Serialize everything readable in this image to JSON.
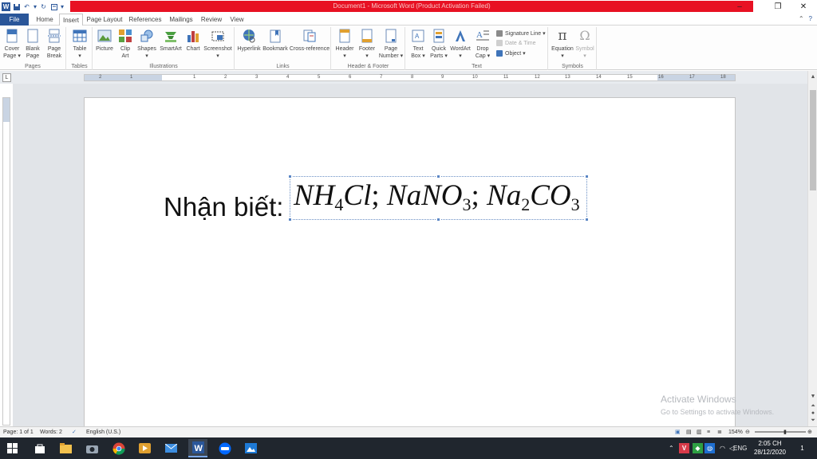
{
  "window": {
    "title": "Document1  -  Microsoft Word (Product Activation Failed)",
    "word_icon": "W"
  },
  "tabs": [
    "File",
    "Home",
    "Insert",
    "Page Layout",
    "References",
    "Mailings",
    "Review",
    "View"
  ],
  "active_tab": "Insert",
  "ribbon": {
    "groups": [
      {
        "label": "Pages",
        "buttons": [
          "Cover\nPage ▾",
          "Blank\nPage",
          "Page\nBreak"
        ]
      },
      {
        "label": "Tables",
        "buttons": [
          "Table\n▾"
        ]
      },
      {
        "label": "Illustrations",
        "buttons": [
          "Picture",
          "Clip\nArt",
          "Shapes\n▾",
          "SmartArt",
          "Chart",
          "Screenshot\n▾"
        ]
      },
      {
        "label": "Links",
        "buttons": [
          "Hyperlink",
          "Bookmark",
          "Cross-reference"
        ]
      },
      {
        "label": "Header & Footer",
        "buttons": [
          "Header\n▾",
          "Footer\n▾",
          "Page\nNumber ▾"
        ]
      },
      {
        "label": "Text",
        "buttons": [
          "Text\nBox ▾",
          "Quick\nParts ▾",
          "WordArt\n▾",
          "Drop\nCap ▾"
        ]
      },
      {
        "label": "Symbols",
        "buttons": [
          "Equation\n▾",
          "Symbol\n▾"
        ]
      }
    ],
    "text_small": [
      "Signature Line ▾",
      "Date & Time",
      "Object ▾"
    ]
  },
  "ruler": {
    "corner": "L",
    "ticks": [
      "2",
      "1",
      "1",
      "2",
      "3",
      "4",
      "5",
      "6",
      "7",
      "8",
      "9",
      "10",
      "11",
      "12",
      "13",
      "14",
      "15",
      "16",
      "17",
      "18"
    ]
  },
  "document": {
    "label": "Nhận biết:",
    "equation": {
      "p1": "NH",
      "s1": "4",
      "p2": "Cl",
      "semi1": ";",
      "p3": "NaNO",
      "s2": "3",
      "semi2": ";",
      "p4": "Na",
      "s3": "2",
      "p5": "CO",
      "s4": "3"
    }
  },
  "watermark": {
    "line1": "Activate Windows",
    "line2": "Go to Settings to activate Windows."
  },
  "statusbar": {
    "page": "Page: 1 of 1",
    "words": "Words: 2",
    "language": "English (U.S.)",
    "zoom": "154%"
  },
  "taskbar": {
    "language": "ENG",
    "time": "2:05 CH",
    "date": "28/12/2020",
    "notifications": "1"
  },
  "colors": {
    "title_bar_warning": "#e81123",
    "file_tab": "#2a5699",
    "taskbar": "#20262e"
  }
}
